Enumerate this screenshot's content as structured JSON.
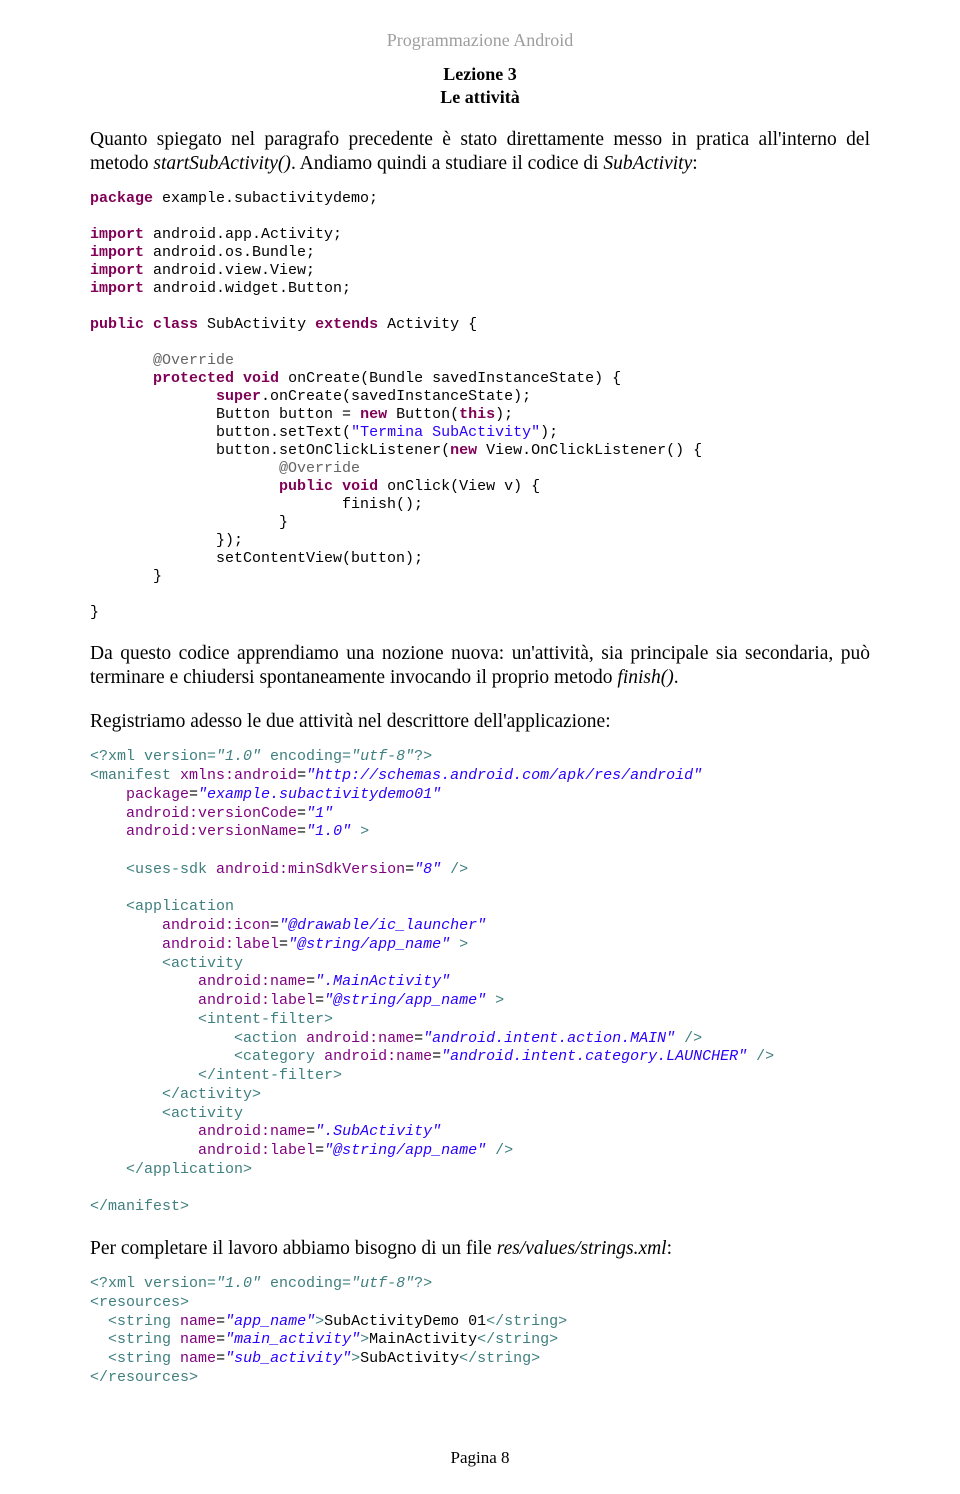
{
  "header": {
    "course": "Programmazione Android",
    "lesson_line1": "Lezione 3",
    "lesson_line2": "Le attività"
  },
  "para1": {
    "t1": "Quanto spiegato nel paragrafo precedente è stato direttamente messo in pratica all'interno del metodo ",
    "m1": "startSubActivity()",
    "t2": ". Andiamo quindi a studiare il codice di ",
    "m2": "SubActivity",
    "t3": ":"
  },
  "code1": {
    "package_kw": "package",
    "package_name": " example.subactivitydemo;",
    "import_kw": "import",
    "imp1": " android.app.Activity;",
    "imp2": " android.os.Bundle;",
    "imp3": " android.view.View;",
    "imp4": " android.widget.Button;",
    "public_kw": "public",
    "class_kw": "class",
    "class_name": " SubActivity ",
    "extends_kw": "extends",
    "extends_name": " Activity {",
    "override": "@Override",
    "protected_kw": "protected",
    "void_kw": "void",
    "onCreate_sig": " onCreate(Bundle savedInstanceState) {",
    "super_kw": "super",
    "super_rest": ".onCreate(savedInstanceState);",
    "btn_decl1": "Button button = ",
    "new_kw": "new",
    "btn_decl2": " Button(",
    "this_kw": "this",
    "btn_decl3": ");",
    "settext1": "button.setText(",
    "settext_str": "\"Termina SubActivity\"",
    "settext2": ");",
    "setclick1": "button.setOnClickListener(",
    "setclick2": " View.OnClickListener() {",
    "onclick_sig": " onClick(View v) {",
    "finish": "finish();",
    "brace_close": "}",
    "end_listener": "});",
    "setcontent": "setContentView(button);"
  },
  "para2": {
    "t1": "Da questo codice apprendiamo una nozione nuova: un'attività, sia principale sia secondaria, può terminare e chiudersi spontaneamente invocando il proprio metodo ",
    "m1": "finish()",
    "t2": "."
  },
  "para3": "Registriamo adesso le due attività nel descrittore dell'applicazione:",
  "xml1": {
    "decl1": "<?xml version=",
    "decl_ver": "\"1.0\"",
    "decl2": " encoding=",
    "decl_enc": "\"utf-8\"",
    "decl3": "?>",
    "manifest_open": "<manifest",
    "xmlns_a": "xmlns:android",
    "xmlns_v": "\"http://schemas.android.com/apk/res/android\"",
    "pkg_a": "package",
    "pkg_v": "\"example.subactivitydemo01\"",
    "vc_a": "android:versionCode",
    "vc_v": "\"1\"",
    "vn_a": "android:versionName",
    "vn_v": "\"1.0\"",
    "gt": " >",
    "uses_sdk": "<uses-sdk",
    "minsdk_a": "android:minSdkVersion",
    "minsdk_v": "\"8\"",
    "selfclose": " />",
    "app_open": "<application",
    "icon_a": "android:icon",
    "icon_v": "\"@drawable/ic_launcher\"",
    "label_a": "android:label",
    "label_v": "\"@string/app_name\"",
    "act_open": "<activity",
    "name_a": "android:name",
    "main_name_v": "\".MainActivity\"",
    "if_open": "<intent-filter>",
    "action_open": "<action",
    "action_v": "\"android.intent.action.MAIN\"",
    "cat_open": "<category",
    "cat_v": "\"android.intent.category.LAUNCHER\"",
    "if_close": "</intent-filter>",
    "act_close": "</activity>",
    "sub_name_v": "\".SubActivity\"",
    "app_close": "</application>",
    "manifest_close": "</manifest>"
  },
  "para4": {
    "t1": "Per completare il lavoro abbiamo bisogno di un file ",
    "m1": "res/values/strings.xml",
    "t2": ":"
  },
  "xml2": {
    "res_open": "<resources>",
    "str_open": "<string",
    "name_a": "name",
    "n1": "\"app_name\"",
    "n2": "\"main_activity\"",
    "n3": "\"sub_activity\"",
    "v1": "SubActivityDemo 01",
    "v2": "MainActivity",
    "v3": "SubActivity",
    "str_close": "</string>",
    "res_close": "</resources>"
  },
  "footer": "Pagina 8"
}
